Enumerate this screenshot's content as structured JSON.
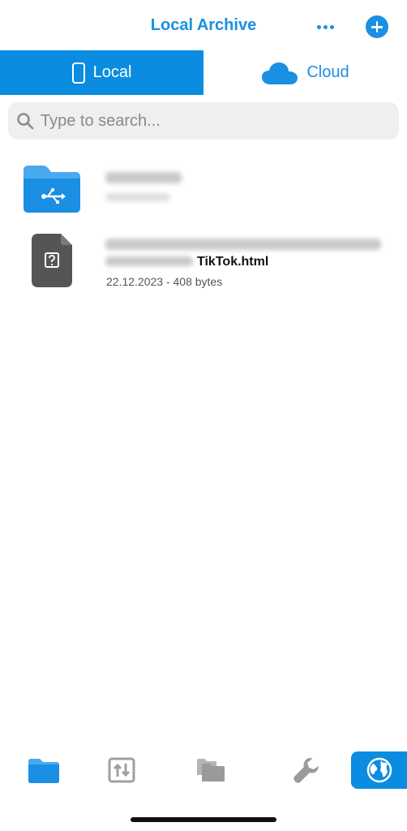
{
  "header": {
    "title": "Local Archive",
    "more_icon": "ellipsis-icon",
    "add_icon": "plus-circle-icon"
  },
  "tabs": [
    {
      "label": "Local",
      "icon": "phone-icon",
      "selected": true
    },
    {
      "label": "Cloud",
      "icon": "cloud-icon",
      "selected": false
    }
  ],
  "search": {
    "placeholder": "Type to search...",
    "value": ""
  },
  "files": [
    {
      "type": "folder",
      "icon": "usb-folder-icon",
      "name_blurred": true,
      "meta_blurred": true
    },
    {
      "type": "file",
      "icon": "unknown-file-icon",
      "name_visible": "TikTok.html",
      "meta": "22.12.2023 - 408 bytes"
    }
  ],
  "toolbar": [
    {
      "icon": "folder-icon",
      "active": false
    },
    {
      "icon": "transfer-icon",
      "active": false
    },
    {
      "icon": "file-manager-icon",
      "active": false
    },
    {
      "icon": "wrench-icon",
      "active": false
    },
    {
      "icon": "globe-icon",
      "active": true
    }
  ],
  "colors": {
    "accent": "#0a8de0",
    "title": "#1a8fe3",
    "search_bg": "#efeff0",
    "file_icon": "#555555"
  }
}
